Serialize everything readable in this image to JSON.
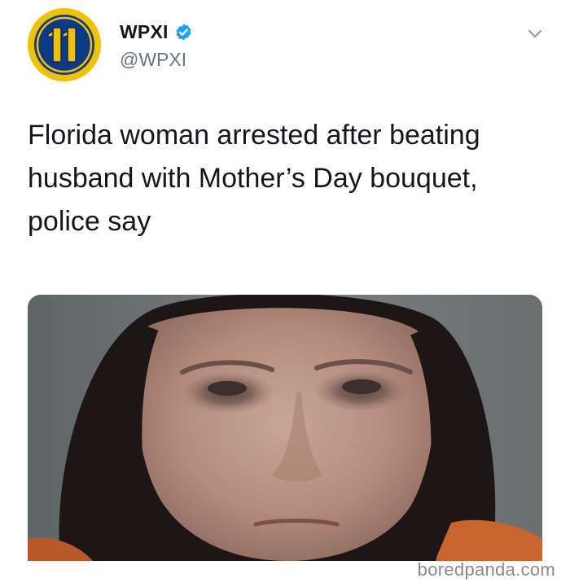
{
  "account": {
    "display_name": "WPXI",
    "handle": "@WPXI",
    "verified": true,
    "avatar_icon": "wpxi-11-logo",
    "avatar_colors": {
      "ring": "#f2c200",
      "disc": "#0b3a87",
      "stroke": "#0a2a66"
    },
    "verified_color": "#1da1f2"
  },
  "menu": {
    "icon": "chevron-down-icon"
  },
  "tweet": {
    "text_lines": [
      "Florida woman arrested after beating",
      "husband with Mother’s Day bouquet,",
      "police say"
    ]
  },
  "media": {
    "type": "photo",
    "subject": "mugshot"
  },
  "watermark": {
    "text": "boredpanda.com"
  }
}
